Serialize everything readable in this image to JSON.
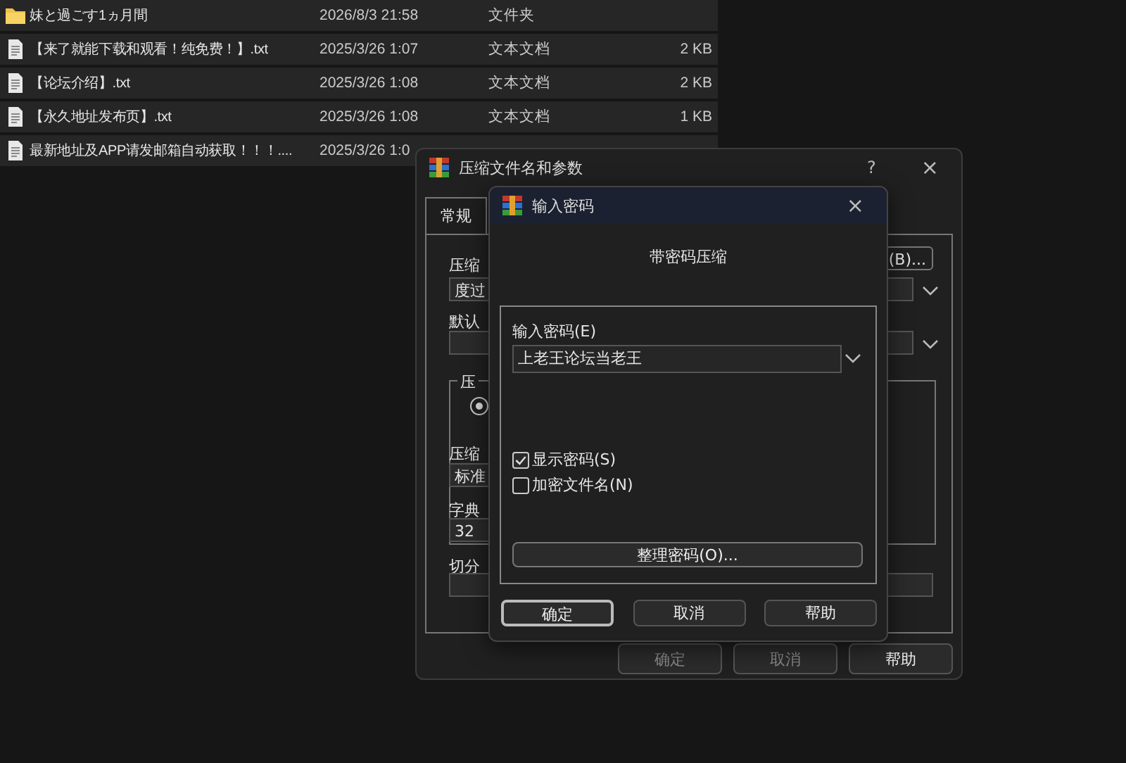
{
  "file_list": {
    "rows": [
      {
        "kind": "folder",
        "name": "妹と過ごす1ヵ月間",
        "date": "2026/8/3 21:58",
        "type": "文件夹"
      },
      {
        "kind": "text",
        "name": "【来了就能下载和观看！纯免费！】.txt",
        "date": "2025/3/26 1:07",
        "type": "文本文档",
        "size": "2 KB"
      },
      {
        "kind": "text",
        "name": "【论坛介绍】.txt",
        "date": "2025/3/26 1:08",
        "type": "文本文档",
        "size": "2 KB"
      },
      {
        "kind": "text",
        "name": "【永久地址发布页】.txt",
        "date": "2025/3/26 1:08",
        "type": "文本文档",
        "size": "1 KB"
      },
      {
        "kind": "text",
        "name": "最新地址及APP请发邮箱自动获取！！！....",
        "date": "2025/3/26 1:0"
      }
    ]
  },
  "archive_dialog": {
    "title": "压缩文件名和参数",
    "help": "?",
    "close": "×",
    "tabs": [
      {
        "label": "常规",
        "selected": true
      }
    ],
    "archive_name_label": "压缩",
    "archive_name_value": "度过",
    "browse_button": "(B)...",
    "profile_label": "默认",
    "group_label": "压",
    "radio_selected": true,
    "method_label": "压缩",
    "method_value": "标准",
    "dictionary_label": "字典",
    "dictionary_value": "32",
    "split_label": "切分",
    "buttons": [
      {
        "label": "确定",
        "disabled": true
      },
      {
        "label": "取消",
        "disabled": true
      },
      {
        "label": "帮助",
        "disabled": false
      }
    ]
  },
  "password_dialog": {
    "title": "输入密码",
    "close": "×",
    "heading": "带密码压缩",
    "password_label": "输入密码(E)",
    "password_value": "上老王论坛当老王",
    "checkboxes": [
      {
        "label": "显示密码(S)",
        "checked": true
      },
      {
        "label": "加密文件名(N)",
        "checked": false
      }
    ],
    "organize_button": "整理密码(O)...",
    "buttons": [
      {
        "label": "确定",
        "default": true
      },
      {
        "label": "取消",
        "default": false
      },
      {
        "label": "帮助",
        "default": false
      }
    ]
  }
}
